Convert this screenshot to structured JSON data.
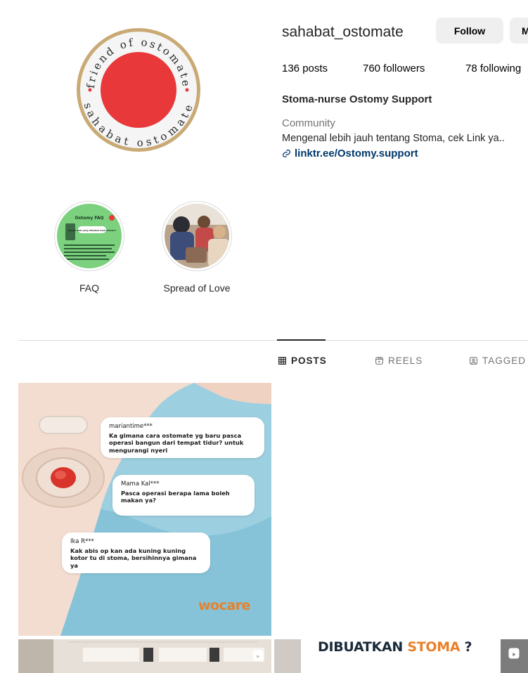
{
  "profile": {
    "username": "sahabat_ostomate",
    "follow_label": "Follow",
    "message_label": "Message",
    "posts": "136 posts",
    "followers": "760 followers",
    "following": "78 following",
    "full_name": "Stoma-nurse Ostomy Support",
    "category": "Community",
    "bio": "Mengenal lebih jauh tentang Stoma, cek Link ya..",
    "link": "linktr.ee/Ostomy.support",
    "avatar_text_top": "friend of ostomate",
    "avatar_text_bottom": "sahabat ostomate"
  },
  "highlights": [
    {
      "label": "FAQ",
      "cover_title": "Ostomy FAQ",
      "cover_question": "Bayam baik yang dimakan hasil dikasih?"
    },
    {
      "label": "Spread of Love"
    }
  ],
  "tabs": [
    {
      "label": "POSTS",
      "icon": "grid-icon",
      "active": true
    },
    {
      "label": "REELS",
      "icon": "reels-icon",
      "active": false
    },
    {
      "label": "TAGGED",
      "icon": "tagged-icon",
      "active": false
    }
  ],
  "posts": {
    "post1": {
      "comments": [
        {
          "name": "mariantime***",
          "text": "Ka gimana cara ostomate yg baru pasca operasi bangun dari tempat tidur? untuk mengurangi nyeri"
        },
        {
          "name": "Mama Kal***",
          "text": "Pasca operasi berapa lama boleh makan ya?"
        },
        {
          "name": "Ika R***",
          "text": "Kak abis op kan ada kuning kuning kotor tu di stoma, bersihinnya gimana ya"
        }
      ],
      "brand": "wocare"
    },
    "post3": {
      "title_prefix": "DIBUATKAN ",
      "title_accent": "STOMA",
      "title_suffix": " ?"
    }
  },
  "colors": {
    "avatar_red": "#e8383a",
    "avatar_ring": "#c9a974",
    "link_blue": "#00376b",
    "brand_orange": "#e8812a",
    "faq_green": "#7bd17e",
    "scrub_blue": "#8fc9dc"
  }
}
